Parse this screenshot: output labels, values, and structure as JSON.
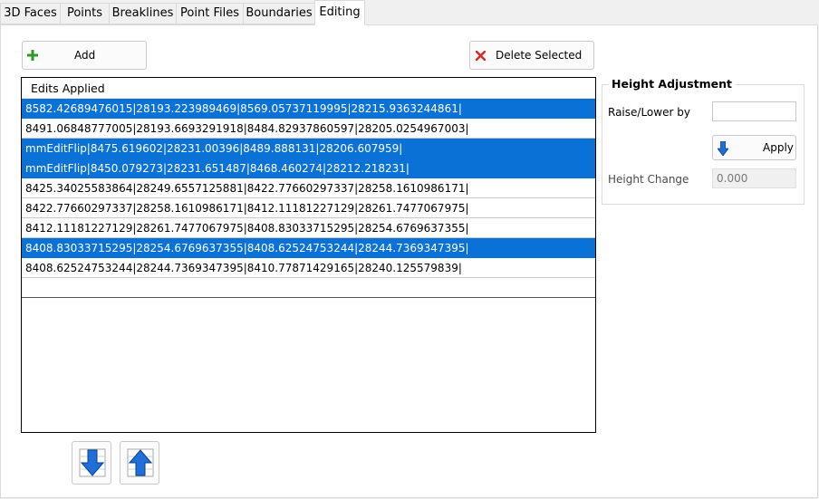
{
  "tabs": [
    {
      "label": "3D Faces",
      "active": false
    },
    {
      "label": "Points",
      "active": false
    },
    {
      "label": "Breaklines",
      "active": false
    },
    {
      "label": "Point Files",
      "active": false
    },
    {
      "label": "Boundaries",
      "active": false
    },
    {
      "label": "Editing",
      "active": true
    }
  ],
  "toolbar": {
    "add_label": "Add",
    "add_icon": "plus-icon",
    "delete_label": "Delete Selected",
    "delete_icon": "red-x-icon"
  },
  "edits_list": {
    "header": "Edits Applied",
    "rows": [
      {
        "text": "8582.42689476015|28193.223989469|8569.05737119995|28215.9363244861|",
        "selected": true
      },
      {
        "text": "8491.06848777005|28193.6693291918|8484.82937860597|28205.0254967003|",
        "selected": false
      },
      {
        "text": "mmEditFlip|8475.619602|28231.00396|8489.888131|28206.607959|",
        "selected": true
      },
      {
        "text": "mmEditFlip|8450.079273|28231.651487|8468.460274|28212.218231|",
        "selected": true
      },
      {
        "text": "8425.34025583864|28249.6557125881|8422.77660297337|28258.1610986171|",
        "selected": false
      },
      {
        "text": "8422.77660297337|28258.1610986171|8412.11181227129|28261.7477067975|",
        "selected": false
      },
      {
        "text": "8412.11181227129|28261.7477067975|8408.83033715295|28254.6769637355|",
        "selected": false
      },
      {
        "text": "8408.83033715295|28254.6769637355|8408.62524753244|28244.7369347395|",
        "selected": true
      },
      {
        "text": "8408.62524753244|28244.7369347395|8410.77871429165|28240.125579839|",
        "selected": false
      }
    ]
  },
  "move_buttons": {
    "down_icon": "move-down-icon",
    "up_icon": "move-up-icon"
  },
  "height_adjustment": {
    "title": "Height Adjustment",
    "raise_label": "Raise/Lower by",
    "raise_value": "",
    "apply_label": "Apply",
    "apply_icon": "down-arrow-icon",
    "height_change_label": "Height Change",
    "height_change_value": "0.000"
  },
  "colors": {
    "selection": "#0a72d6",
    "arrow_blue": "#1e6fd9"
  }
}
